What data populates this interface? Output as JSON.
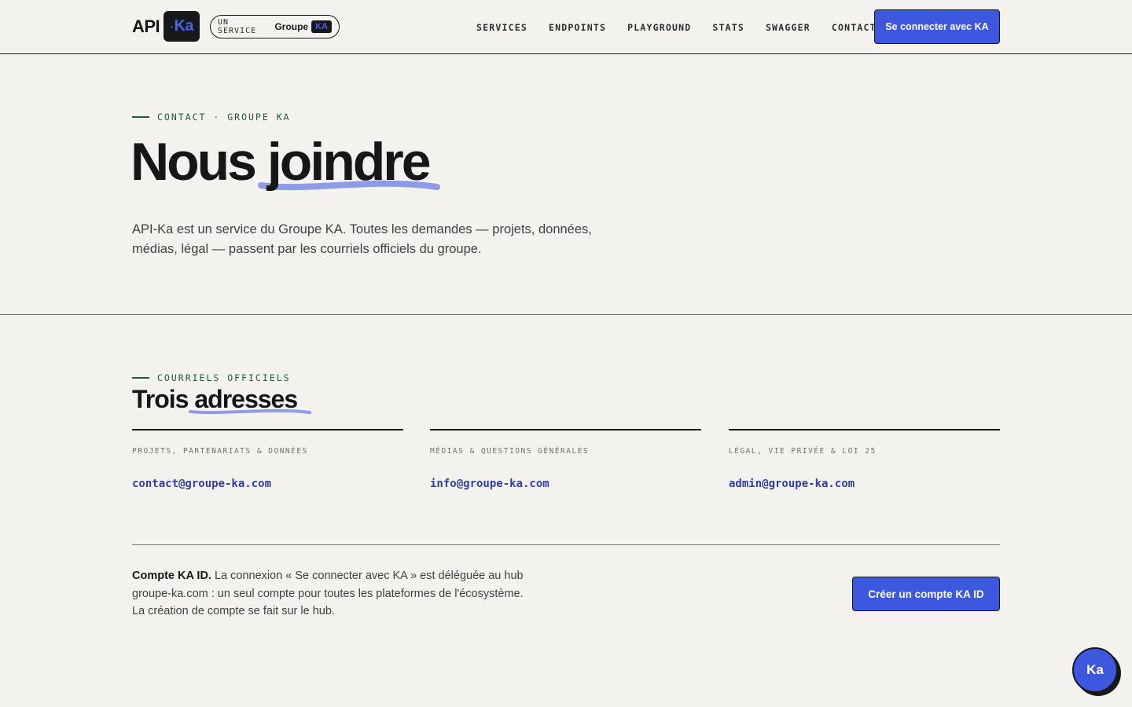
{
  "header": {
    "logo_api": "API",
    "logo_ka": "Ka",
    "service_label": "UN SERVICE",
    "service_group": "Groupe",
    "service_ka": "KA",
    "nav": [
      "SERVICES",
      "ENDPOINTS",
      "PLAYGROUND",
      "STATS",
      "SWAGGER",
      "CONTACT"
    ],
    "login_button": "Se connecter avec KA"
  },
  "hero": {
    "eyebrow": "CONTACT · GROUPE KA",
    "title_part1": "Nous",
    "title_part2": "joindre",
    "description": "API-Ka est un service du Groupe KA. Toutes les demandes — projets, données, médias, légal — passent par les courriels officiels du groupe."
  },
  "addresses": {
    "eyebrow": "COURRIELS OFFICIELS",
    "title_part1": "Trois",
    "title_part2": "adresses",
    "items": [
      {
        "category": "PROJETS, PARTENARIATS & DONNÉES",
        "email": "contact@groupe-ka.com"
      },
      {
        "category": "MÉDIAS & QUESTIONS GÉNÉRALES",
        "email": "info@groupe-ka.com"
      },
      {
        "category": "LÉGAL, VIE PRIVÉE & LOI 25",
        "email": "admin@groupe-ka.com"
      }
    ]
  },
  "account": {
    "title": "Compte KA ID.",
    "text": "La connexion « Se connecter avec KA » est déléguée au hub groupe-ka.com : un seul compte pour toutes les plateformes de l'écosystème. La création de compte se fait sur le hub.",
    "button": "Créer un compte KA ID"
  },
  "fab_label": "Ka",
  "colors": {
    "accent": "#3d57df",
    "background": "#f3f2ee",
    "eyebrow_green": "#1c5a3a",
    "highlight": "#8f9be6"
  }
}
